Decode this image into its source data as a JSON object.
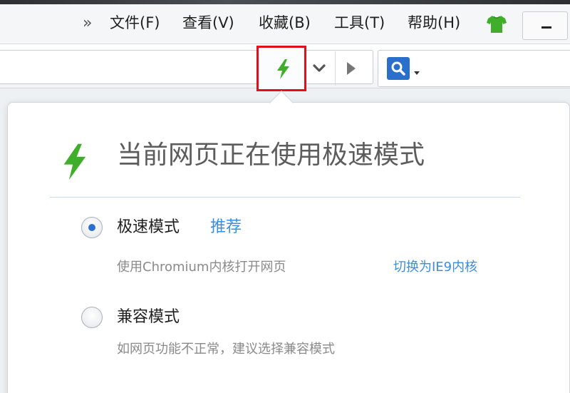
{
  "menu": {
    "overflow_glyph": "»",
    "items": [
      "文件(F)",
      "查看(V)",
      "收藏(B)",
      "工具(T)",
      "帮助(H)"
    ]
  },
  "toolbar": {
    "icons": {
      "speed_mode": "lightning-icon",
      "dropdown": "chevron-down-icon",
      "forward": "play-forward-icon",
      "search": "search-icon",
      "skin": "tshirt-icon"
    }
  },
  "popup": {
    "title": "当前网页正在使用极速模式",
    "options": [
      {
        "label": "极速模式",
        "tag": "推荐",
        "description": "使用Chromium内核打开网页",
        "action": "切换为IE9内核",
        "selected": true
      },
      {
        "label": "兼容模式",
        "description": "如网页功能不正常，建议选择兼容模式",
        "selected": false
      }
    ]
  },
  "colors": {
    "accent_green": "#3fae2a",
    "highlight_red": "#e0101a",
    "link_blue": "#3b8ede",
    "radio_blue": "#2f6fd1",
    "search_blue": "#2a6fc9"
  }
}
